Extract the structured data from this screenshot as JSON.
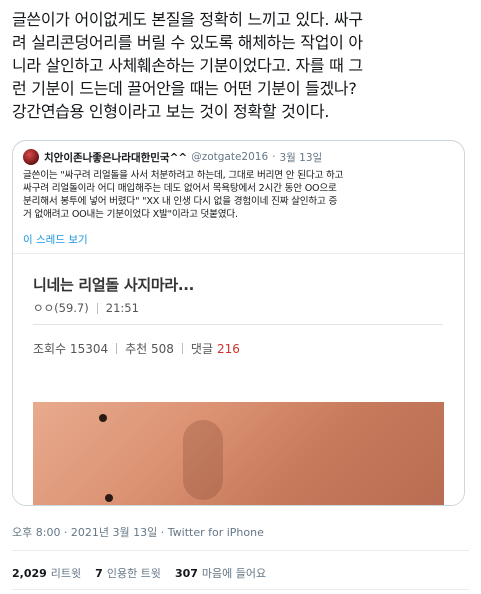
{
  "tweet": {
    "text": "글쓴이가 어이없게도 본질을 정확히 느끼고 있다. 싸구\n려 실리콘덩어리를 버릴 수 있도록 해체하는 작업이 아\n니라 살인하고 사체훼손하는 기분이었다고. 자를 때 그\n런 기분이 드는데 끌어안을 때는 어떤 기분이 들겠나?\n강간연습용 인형이라고 보는 것이 정확할 것이다."
  },
  "quote": {
    "name": "치안이존나좋은나라대한민국^^",
    "handle": "@zotgate2016",
    "separator": "·",
    "date": "3월 13일",
    "body": "글쓴이는 \"싸구려 리얼돌을 사서 처분하려고 하는데, 그대로 버리면 안 된다고 하고\n싸구려 리얼돌이라 어디 매입해주는 데도 없어서 목욕탕에서 2시간 동안 OO으로\n분리해서 봉투에 넣어 버렸다\" \"XX 내 인생 다시 없을 경험이네 진짜 살인하고 증\n거 없애려고 OO내는 기분이었다 X발\"이라고 덧붙였다.",
    "thread_link": "이 스레드 보기",
    "media": {
      "post_title": "니네는 리얼돌 사지마라...",
      "author": "ㅇㅇ(59.7)",
      "time": "21:51",
      "views_label": "조회수 15304",
      "recommend_label": "추천 508",
      "comments_label": "댓글",
      "comments_count": "216",
      "comments_color": "#d0312d"
    }
  },
  "meta": {
    "time_date": "오후 8:00 · 2021년 3월 13일 · Twitter for iPhone"
  },
  "stats": {
    "retweets_count": "2,029",
    "retweets_label": "리트윗",
    "quotes_count": "7",
    "quotes_label": "인용한 트윗",
    "likes_count": "307",
    "likes_label": "마음에 들어요"
  },
  "colors": {
    "link": "#1b95e0",
    "muted": "#657786",
    "border": "#ccd6dd"
  }
}
